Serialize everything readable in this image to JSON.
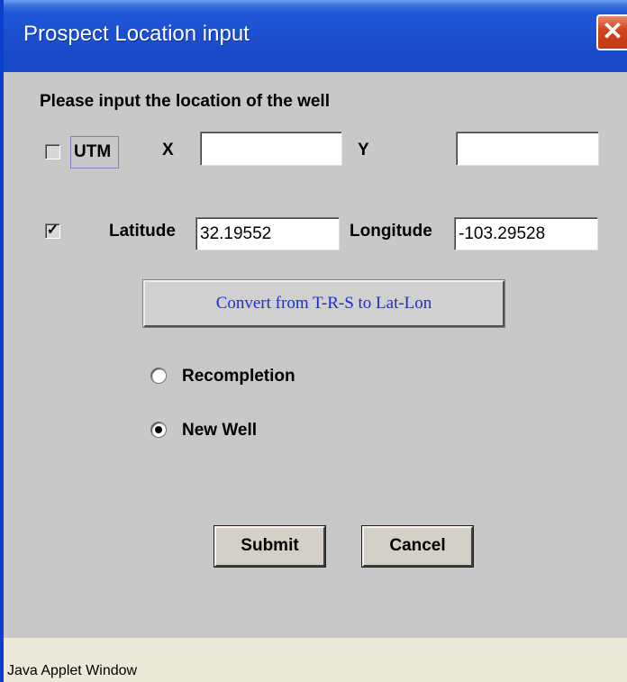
{
  "window": {
    "title": "Prospect Location input",
    "close_glyph": "✕"
  },
  "form": {
    "heading": "Please input the location of the well",
    "utm": {
      "label": "UTM",
      "checked": false
    },
    "x_label": "X",
    "x_value": "",
    "y_label": "Y",
    "y_value": "",
    "latlon": {
      "checked": true,
      "check_glyph": "✓"
    },
    "latitude_label": "Latitude",
    "latitude_value": "32.19552",
    "longitude_label": "Longitude",
    "longitude_value": "-103.29528",
    "convert_button": "Convert from T-R-S to Lat-Lon",
    "well_type": {
      "options": [
        "Recompletion",
        "New Well"
      ],
      "selected": "New Well"
    },
    "submit_label": "Submit",
    "cancel_label": "Cancel"
  },
  "statusbar": {
    "text": "Java Applet Window"
  }
}
